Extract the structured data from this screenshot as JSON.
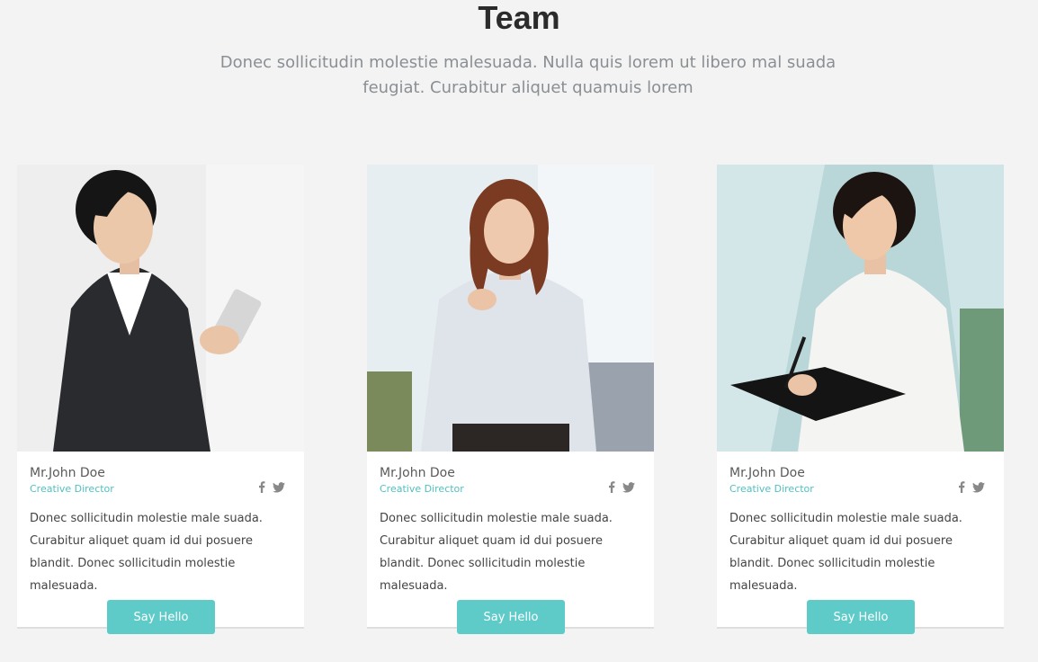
{
  "section": {
    "title": "Team",
    "subtitle": "Donec sollicitudin molestie malesuada. Nulla quis lorem ut libero mal suada feugiat. Curabitur aliquet quamuis lorem"
  },
  "members": [
    {
      "name": "Mr.John Doe",
      "role": "Creative Director",
      "description": "Donec sollicitudin molestie male suada. Curabitur aliquet quam id dui posuere blandit. Donec sollicitudin molestie malesuada.",
      "button_label": "Say Hello",
      "social_icons": [
        "facebook-icon",
        "twitter-icon"
      ]
    },
    {
      "name": "Mr.John Doe",
      "role": "Creative Director",
      "description": "Donec sollicitudin molestie male suada. Curabitur aliquet quam id dui posuere blandit. Donec sollicitudin molestie malesuada.",
      "button_label": "Say Hello",
      "social_icons": [
        "facebook-icon",
        "twitter-icon"
      ]
    },
    {
      "name": "Mr.John Doe",
      "role": "Creative Director",
      "description": "Donec sollicitudin molestie male suada. Curabitur aliquet quam id dui posuere blandit. Donec sollicitudin molestie malesuada.",
      "button_label": "Say Hello",
      "social_icons": [
        "facebook-icon",
        "twitter-icon"
      ]
    }
  ],
  "colors": {
    "page_background": "#f3f3f3",
    "accent": "#5ecbc8",
    "role_text": "#4fc1c1",
    "title_text": "#2b2b2b",
    "subtitle_text": "#8a8f93"
  }
}
